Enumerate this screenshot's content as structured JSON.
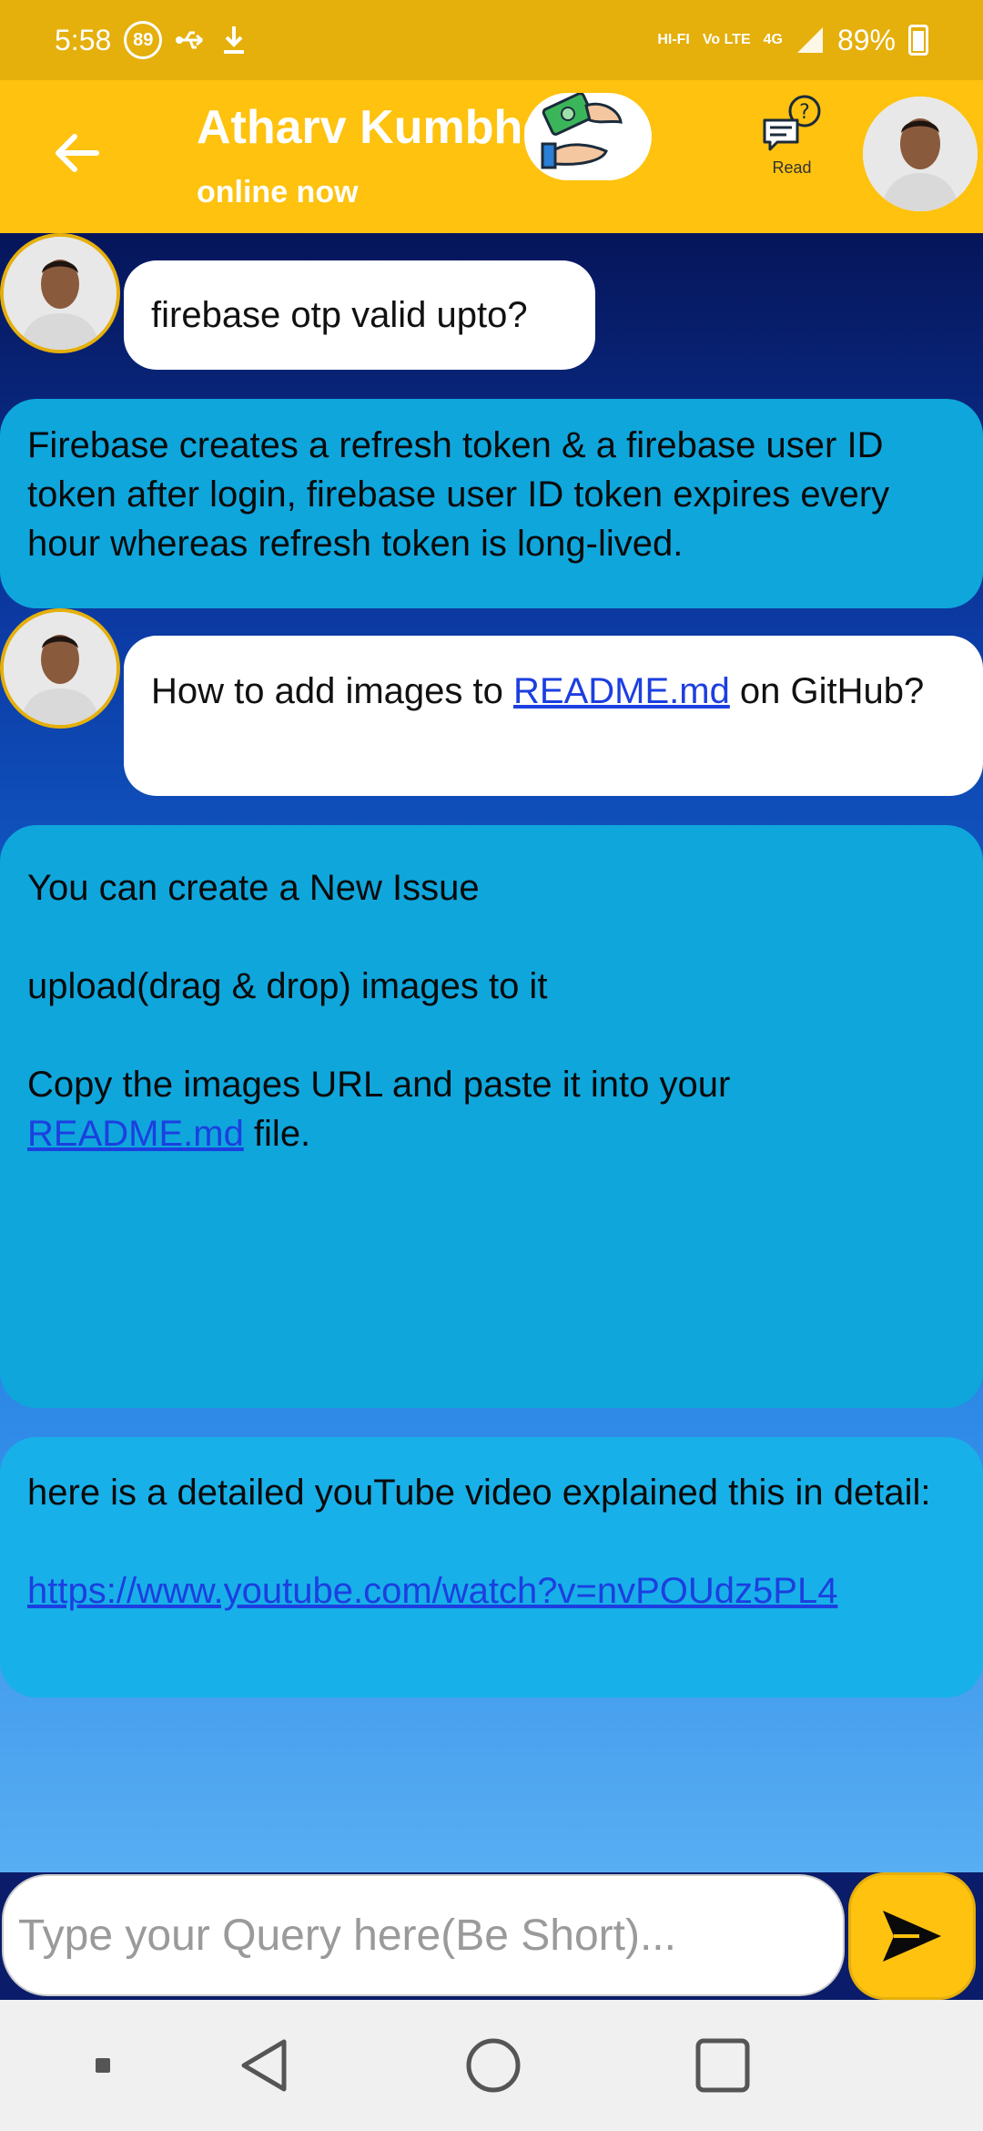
{
  "status_bar": {
    "time": "5:58",
    "notification_count": "89",
    "network_hd": "HI-FI",
    "volte": "Vo LTE",
    "network_type": "4G",
    "battery_percent": "89%"
  },
  "header": {
    "contact_name": "Atharv Kumbhej",
    "contact_status": "online now",
    "read_label": "Read"
  },
  "messages": [
    {
      "role": "user",
      "text": "firebase otp valid upto?"
    },
    {
      "role": "bot",
      "text": "Firebase creates a refresh token & a firebase user ID token after login, firebase user ID token expires every hour whereas refresh token is long-lived."
    },
    {
      "role": "user",
      "text_before": "How to add images to ",
      "link": "README.md",
      "text_after": " on GitHub?"
    },
    {
      "role": "bot",
      "line1": "You can create a New Issue",
      "line2": "upload(drag & drop) images to it",
      "line3": "Copy the images URL and paste it into your",
      "link": "README.md",
      "line3_after": " file."
    },
    {
      "role": "bot",
      "text": "here is a detailed youTube video explained this in detail:",
      "link": "https://www.youtube.com/watch?v=nvPOUdz5PL4"
    }
  ],
  "input": {
    "placeholder": "Type your Query here(Be Short)...",
    "value": ""
  },
  "colors": {
    "status_bar": "#e5af0c",
    "header": "#fec20f",
    "bot_bubble": "#0fa6dc",
    "user_bubble": "#ffffff",
    "link": "#1c3fe0"
  }
}
